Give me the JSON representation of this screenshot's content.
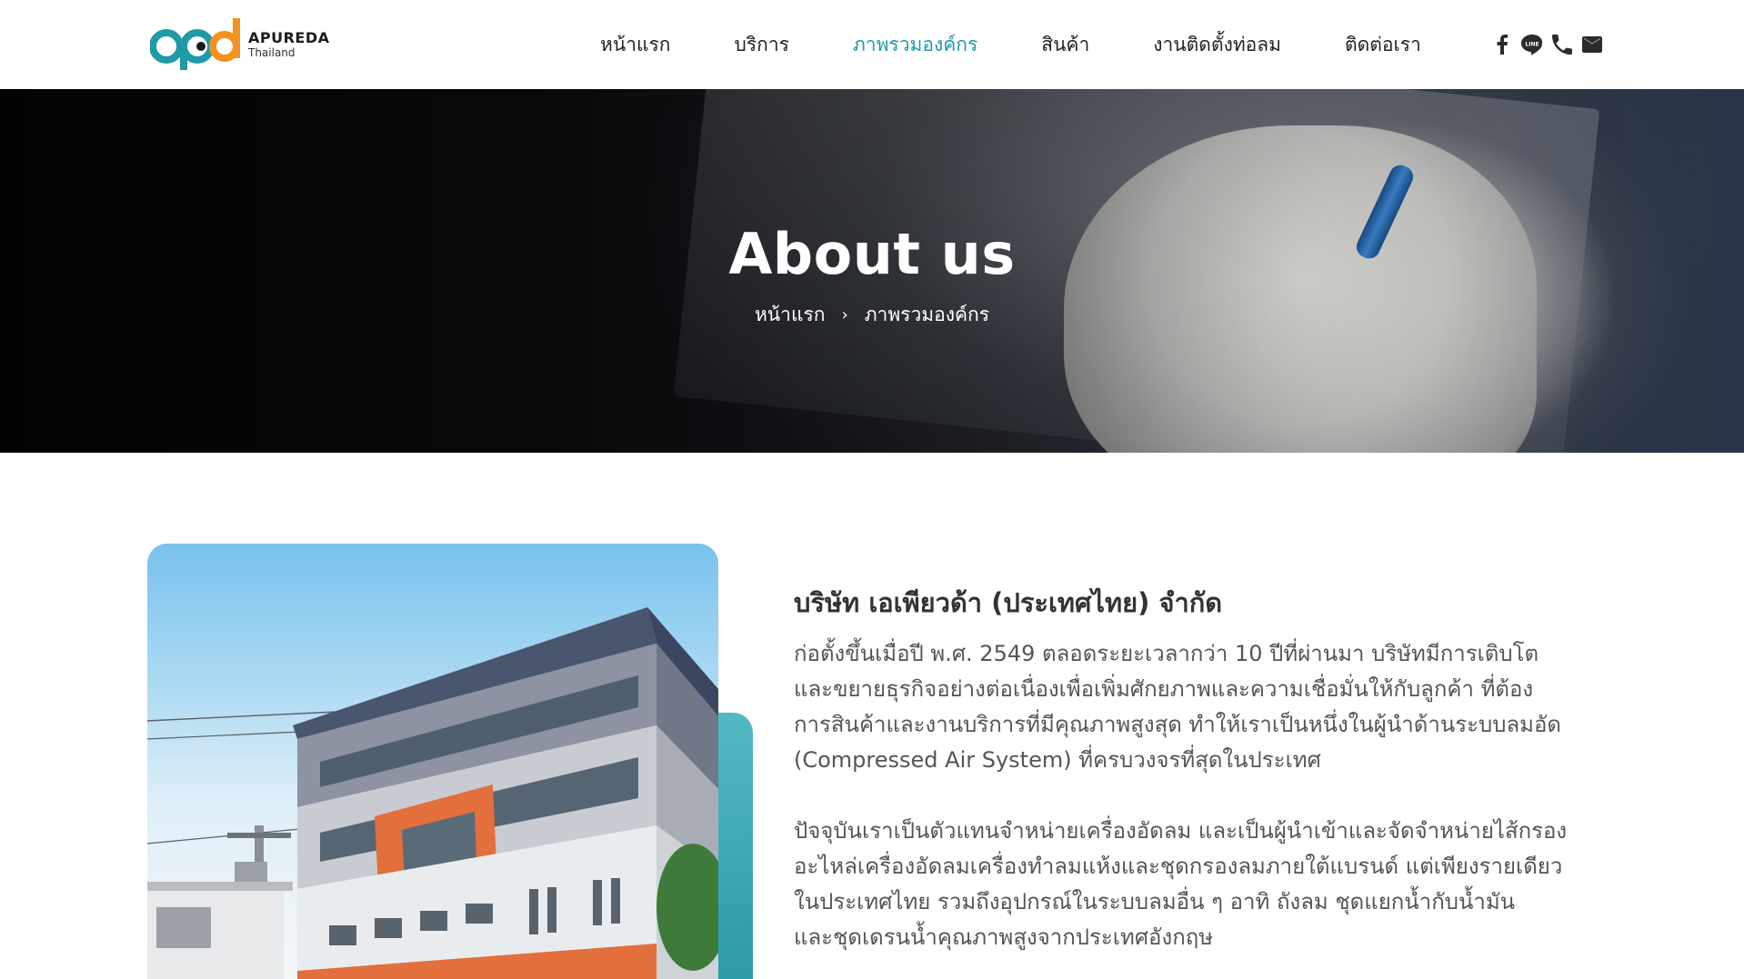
{
  "logo": {
    "mark": "apd",
    "name": "APUREDA",
    "sub": "Thailand",
    "colors": {
      "teal": "#1f9aa6",
      "orange": "#f39221",
      "dark": "#1a1a1a"
    }
  },
  "nav": {
    "items": [
      {
        "label": "หน้าแรก",
        "active": false
      },
      {
        "label": "บริการ",
        "active": false
      },
      {
        "label": "ภาพรวมองค์กร",
        "active": true
      },
      {
        "label": "สินค้า",
        "active": false
      },
      {
        "label": "งานติดตั้งท่อลม",
        "active": false
      },
      {
        "label": "ติดต่อเรา",
        "active": false
      }
    ],
    "active_color": "#1f9aa6"
  },
  "social": [
    {
      "icon": "facebook-icon"
    },
    {
      "icon": "line-icon",
      "text": "LINE"
    },
    {
      "icon": "phone-icon"
    },
    {
      "icon": "mail-icon"
    }
  ],
  "hero": {
    "title": "About us",
    "breadcrumb": {
      "home": "หน้าแรก",
      "separator": "›",
      "current": "ภาพรวมองค์กร"
    }
  },
  "about": {
    "title": "บริษัท เอเพียวด้า (ประเทศไทย) จำกัด",
    "paragraphs": [
      [
        "ก่อตั้งขึ้นเมื่อปี พ.ศ. 2549 ตลอดระยะเวลากว่า 10 ปีที่ผ่านมา บริษัทมีการเติบโต",
        "และขยายธุรกิจอย่างต่อเนื่องเพื่อเพิ่มศักยภาพและความเชื่อมั่นให้กับลูกค้า ที่ต้อง",
        "การสินค้าและงานบริการที่มีคุณภาพสูงสุด ทำให้เราเป็นหนึ่งในผู้นำด้านระบบลมอัด",
        "(Compressed Air System) ที่ครบวงจรที่สุดในประเทศ"
      ],
      [
        "ปัจจุบันเราเป็นตัวแทนจำหน่ายเครื่องอัดลม และเป็นผู้นำเข้าและจัดจำหน่ายไส้กรอง",
        "อะไหล่เครื่องอัดลมเครื่องทำลมแห้งและชุดกรองลมภายใต้แบรนด์ แต่เพียงรายเดียว",
        "ในประเทศไทย รวมถึงอุปกรณ์ในระบบลมอื่น ๆ อาทิ ถังลม ชุดแยกน้ำกับน้ำมัน",
        "และชุดเดรนน้ำคุณภาพสูงจากประเทศอังกฤษ"
      ]
    ]
  }
}
